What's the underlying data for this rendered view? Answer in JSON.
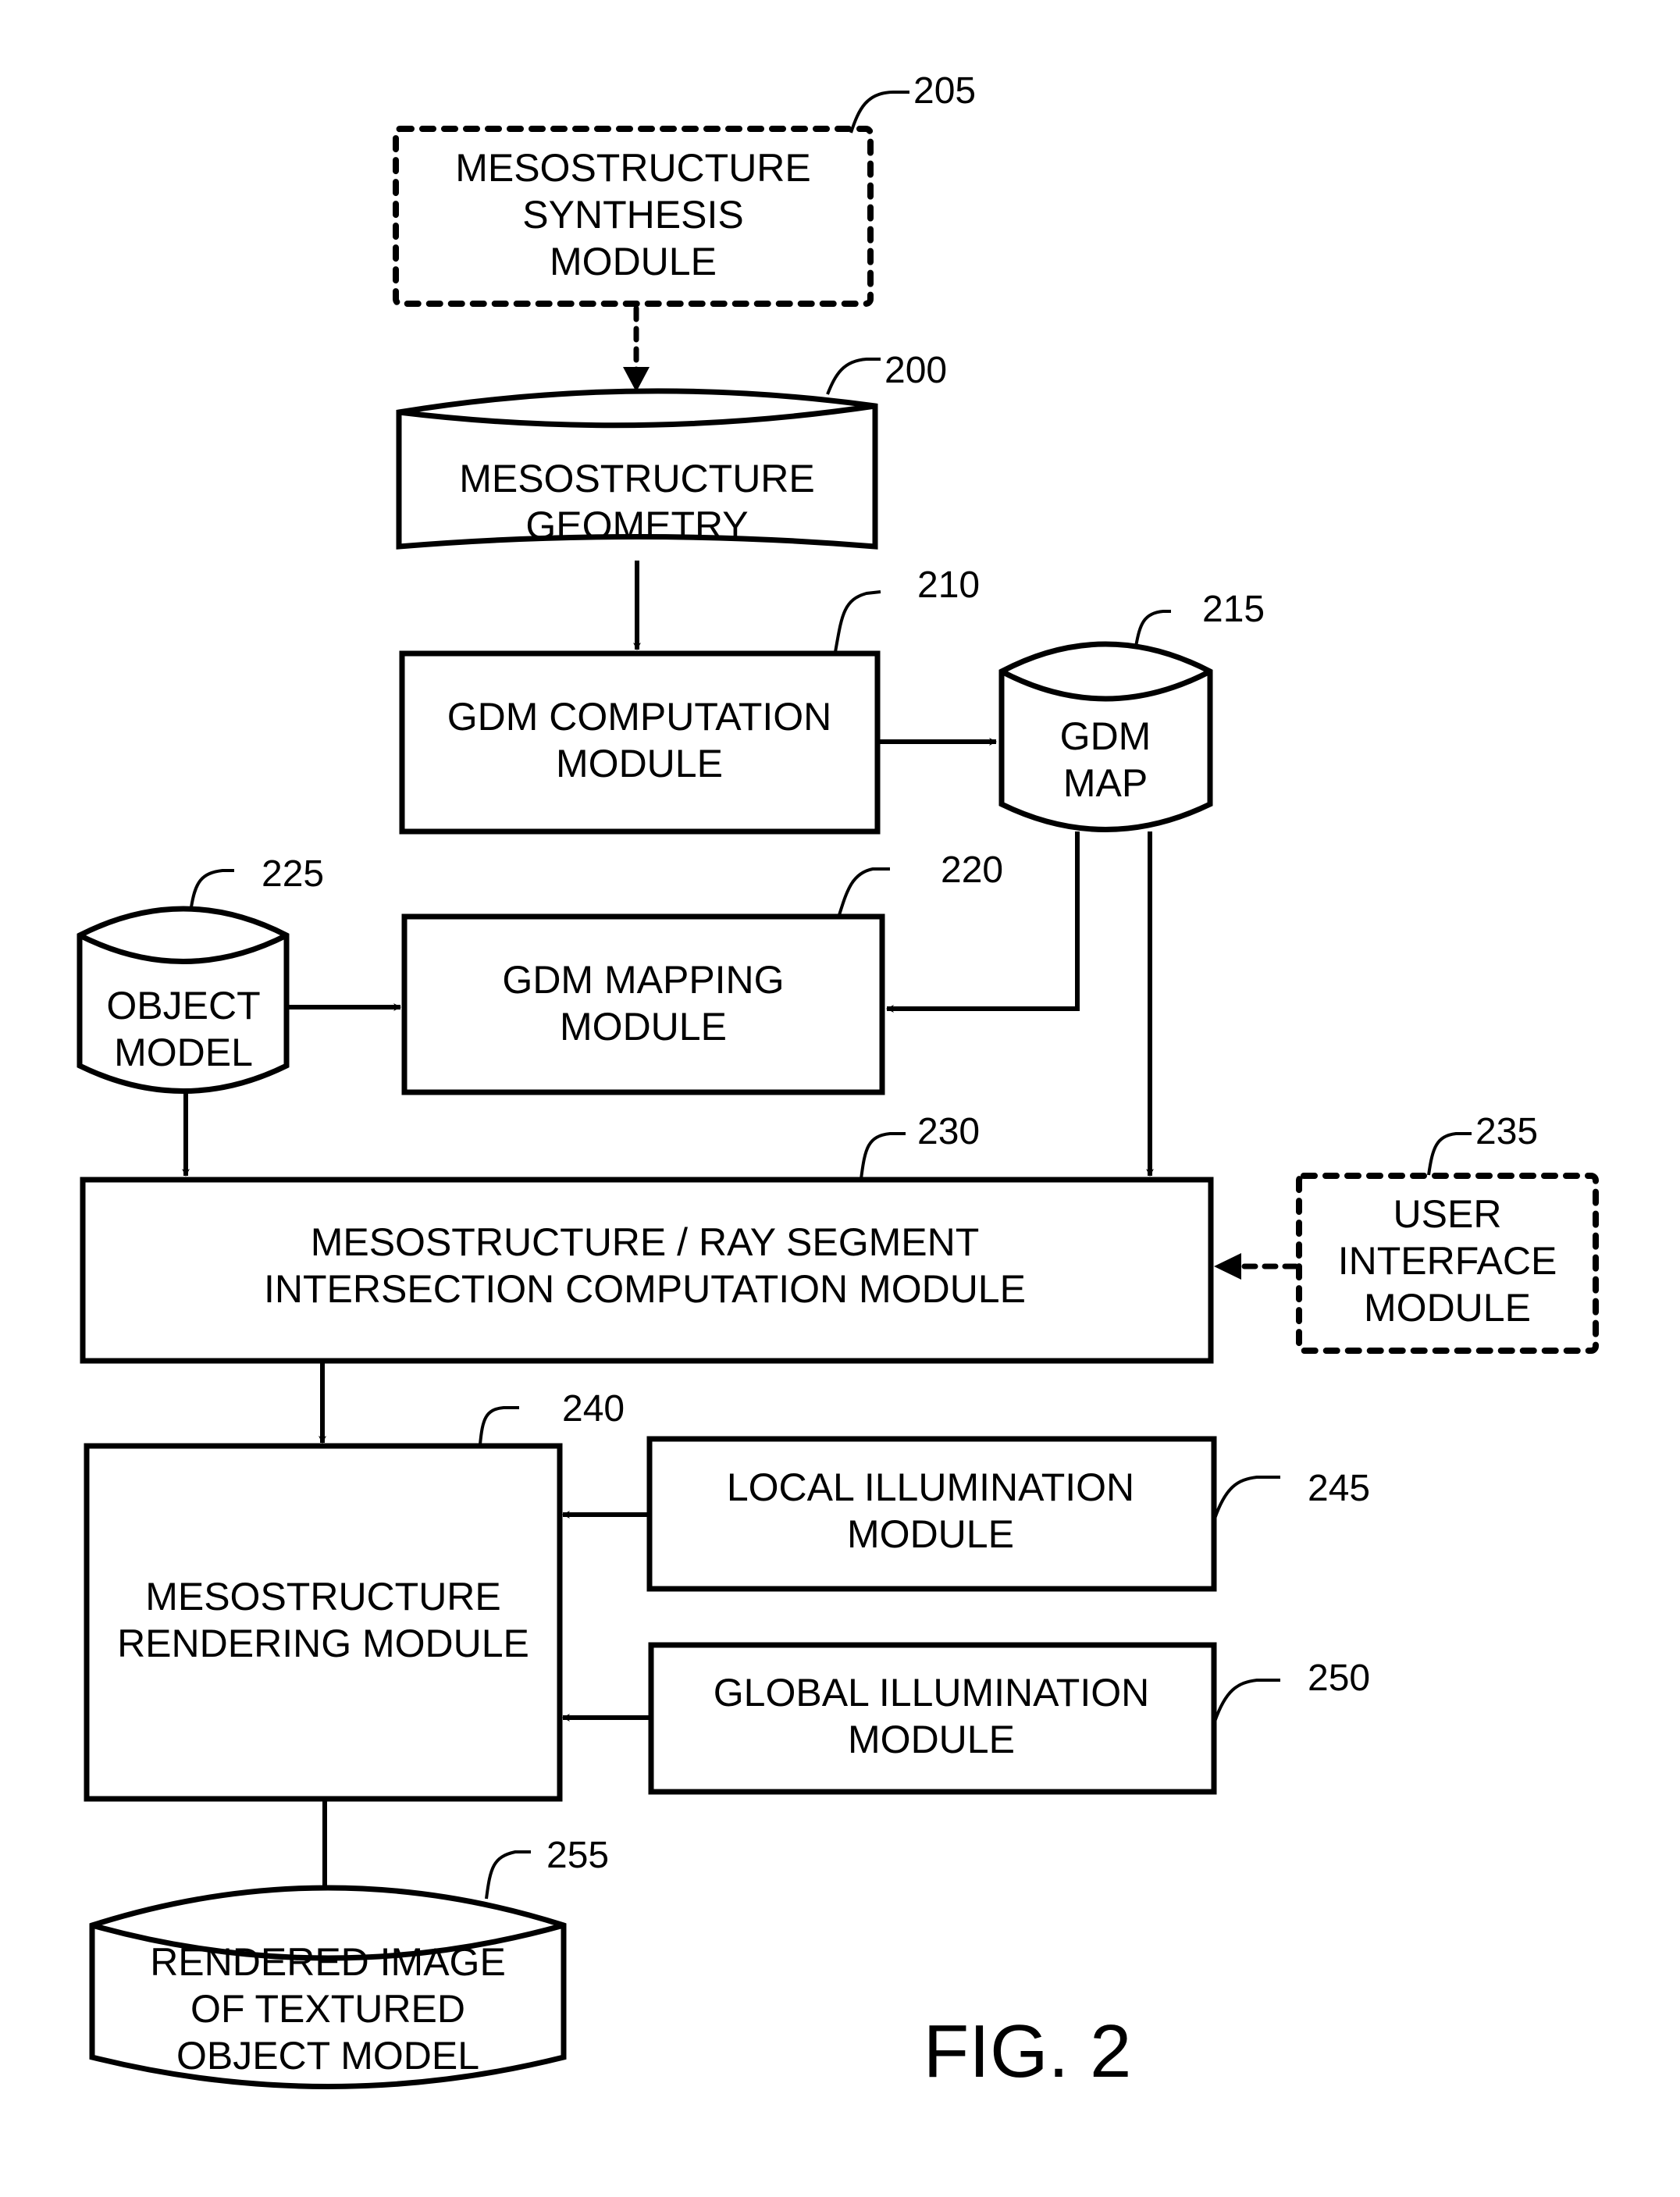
{
  "figure": {
    "title": "FIG. 2"
  },
  "nodes": {
    "n205": {
      "ref": "205",
      "shape": "dashed-box",
      "lines": [
        "MESOSTRUCTURE",
        "SYNTHESIS",
        "MODULE"
      ]
    },
    "n200": {
      "ref": "200",
      "shape": "storage-cylinder",
      "lines": [
        "MESOSTRUCTURE",
        "GEOMETRY"
      ]
    },
    "n210": {
      "ref": "210",
      "shape": "box",
      "lines": [
        "GDM COMPUTATION",
        "MODULE"
      ]
    },
    "n215": {
      "ref": "215",
      "shape": "storage-cylinder",
      "lines": [
        "GDM",
        "MAP"
      ]
    },
    "n225": {
      "ref": "225",
      "shape": "storage-cylinder",
      "lines": [
        "OBJECT",
        "MODEL"
      ]
    },
    "n220": {
      "ref": "220",
      "shape": "box",
      "lines": [
        "GDM MAPPING",
        "MODULE"
      ]
    },
    "n230": {
      "ref": "230",
      "shape": "box",
      "lines": [
        "MESOSTRUCTURE / RAY SEGMENT",
        "INTERSECTION COMPUTATION MODULE"
      ]
    },
    "n235": {
      "ref": "235",
      "shape": "dashed-box",
      "lines": [
        "USER",
        "INTERFACE",
        "MODULE"
      ]
    },
    "n240": {
      "ref": "240",
      "shape": "box",
      "lines": [
        "MESOSTRUCTURE",
        "RENDERING MODULE"
      ]
    },
    "n245": {
      "ref": "245",
      "shape": "box",
      "lines": [
        "LOCAL ILLUMINATION",
        "MODULE"
      ]
    },
    "n250": {
      "ref": "250",
      "shape": "box",
      "lines": [
        "GLOBAL ILLUMINATION",
        "MODULE"
      ]
    },
    "n255": {
      "ref": "255",
      "shape": "storage-cylinder",
      "lines": [
        "RENDERED IMAGE",
        "OF TEXTURED",
        "OBJECT MODEL"
      ]
    }
  },
  "edges": [
    {
      "from": "205",
      "to": "200",
      "style": "dashed"
    },
    {
      "from": "200",
      "to": "210",
      "style": "solid"
    },
    {
      "from": "210",
      "to": "215",
      "style": "solid"
    },
    {
      "from": "215",
      "to": "220",
      "style": "solid"
    },
    {
      "from": "215",
      "to": "230",
      "style": "solid"
    },
    {
      "from": "225",
      "to": "220",
      "style": "solid"
    },
    {
      "from": "225",
      "to": "230",
      "style": "solid"
    },
    {
      "from": "235",
      "to": "230",
      "style": "dashed"
    },
    {
      "from": "230",
      "to": "240",
      "style": "solid"
    },
    {
      "from": "245",
      "to": "240",
      "style": "solid"
    },
    {
      "from": "250",
      "to": "240",
      "style": "solid"
    },
    {
      "from": "240",
      "to": "255",
      "style": "solid"
    }
  ]
}
